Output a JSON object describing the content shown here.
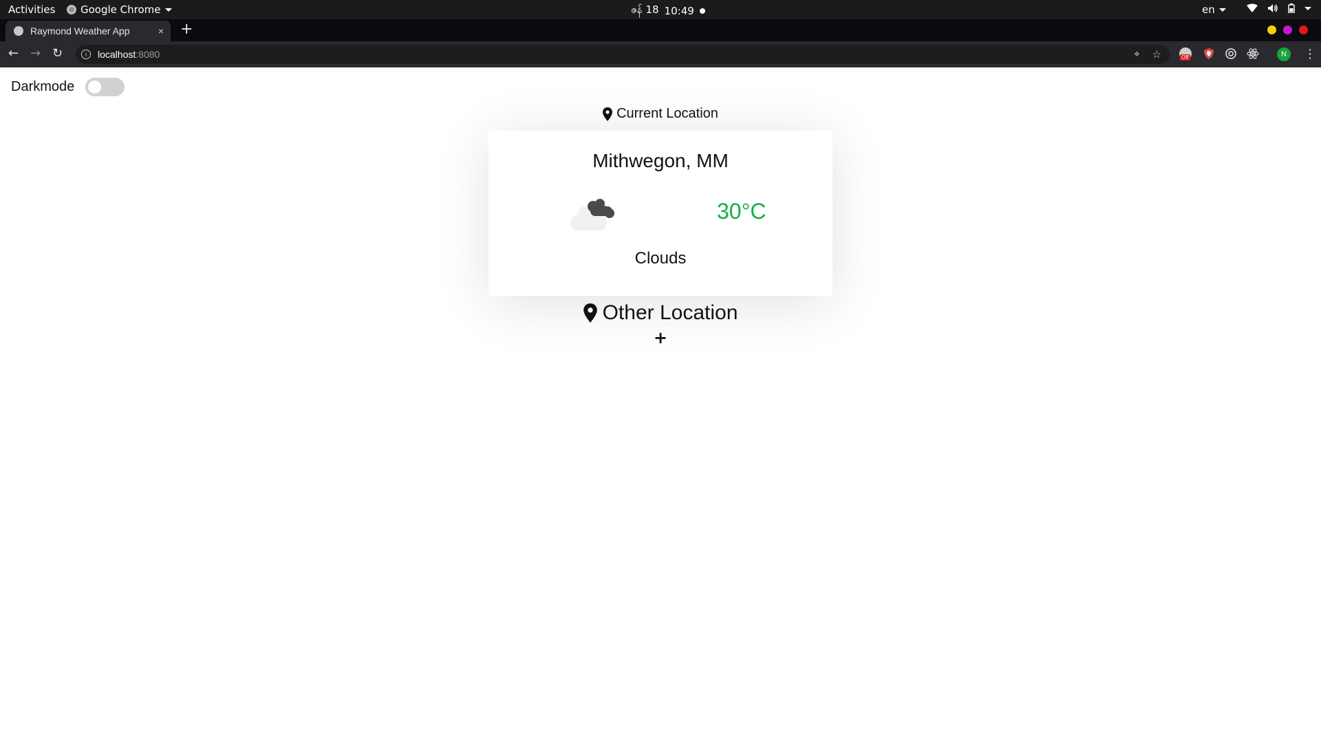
{
  "system_bar": {
    "activities": "Activities",
    "app_name": "Google Chrome",
    "date": "ဇန် 18",
    "time": "10:49",
    "language": "en"
  },
  "browser": {
    "tab_title": "Raymond Weather App",
    "tab_close": "×",
    "new_tab": "+",
    "url_host": "localhost",
    "url_port": ":8080",
    "back": "←",
    "forward": "→",
    "reload": "↻",
    "menu": "⋮",
    "profile_initial": "N",
    "extension_badge": "Off",
    "window_controls": [
      "#f5d000",
      "#c416d6",
      "#e6141b"
    ]
  },
  "app": {
    "darkmode_label": "Darkmode",
    "darkmode_on": false,
    "current_location_heading": "Current Location",
    "current": {
      "city": "Mithwegon, MM",
      "temperature": "30°C",
      "condition": "Clouds",
      "icon": "broken-clouds-icon"
    },
    "other_location_heading": "Other Location",
    "add_location_label": "+"
  },
  "colors": {
    "temperature": "#15b045",
    "toggle_off": "#d1d1d1",
    "topbar": "#1b1b1b",
    "toolbar": "#2a2a2e"
  }
}
